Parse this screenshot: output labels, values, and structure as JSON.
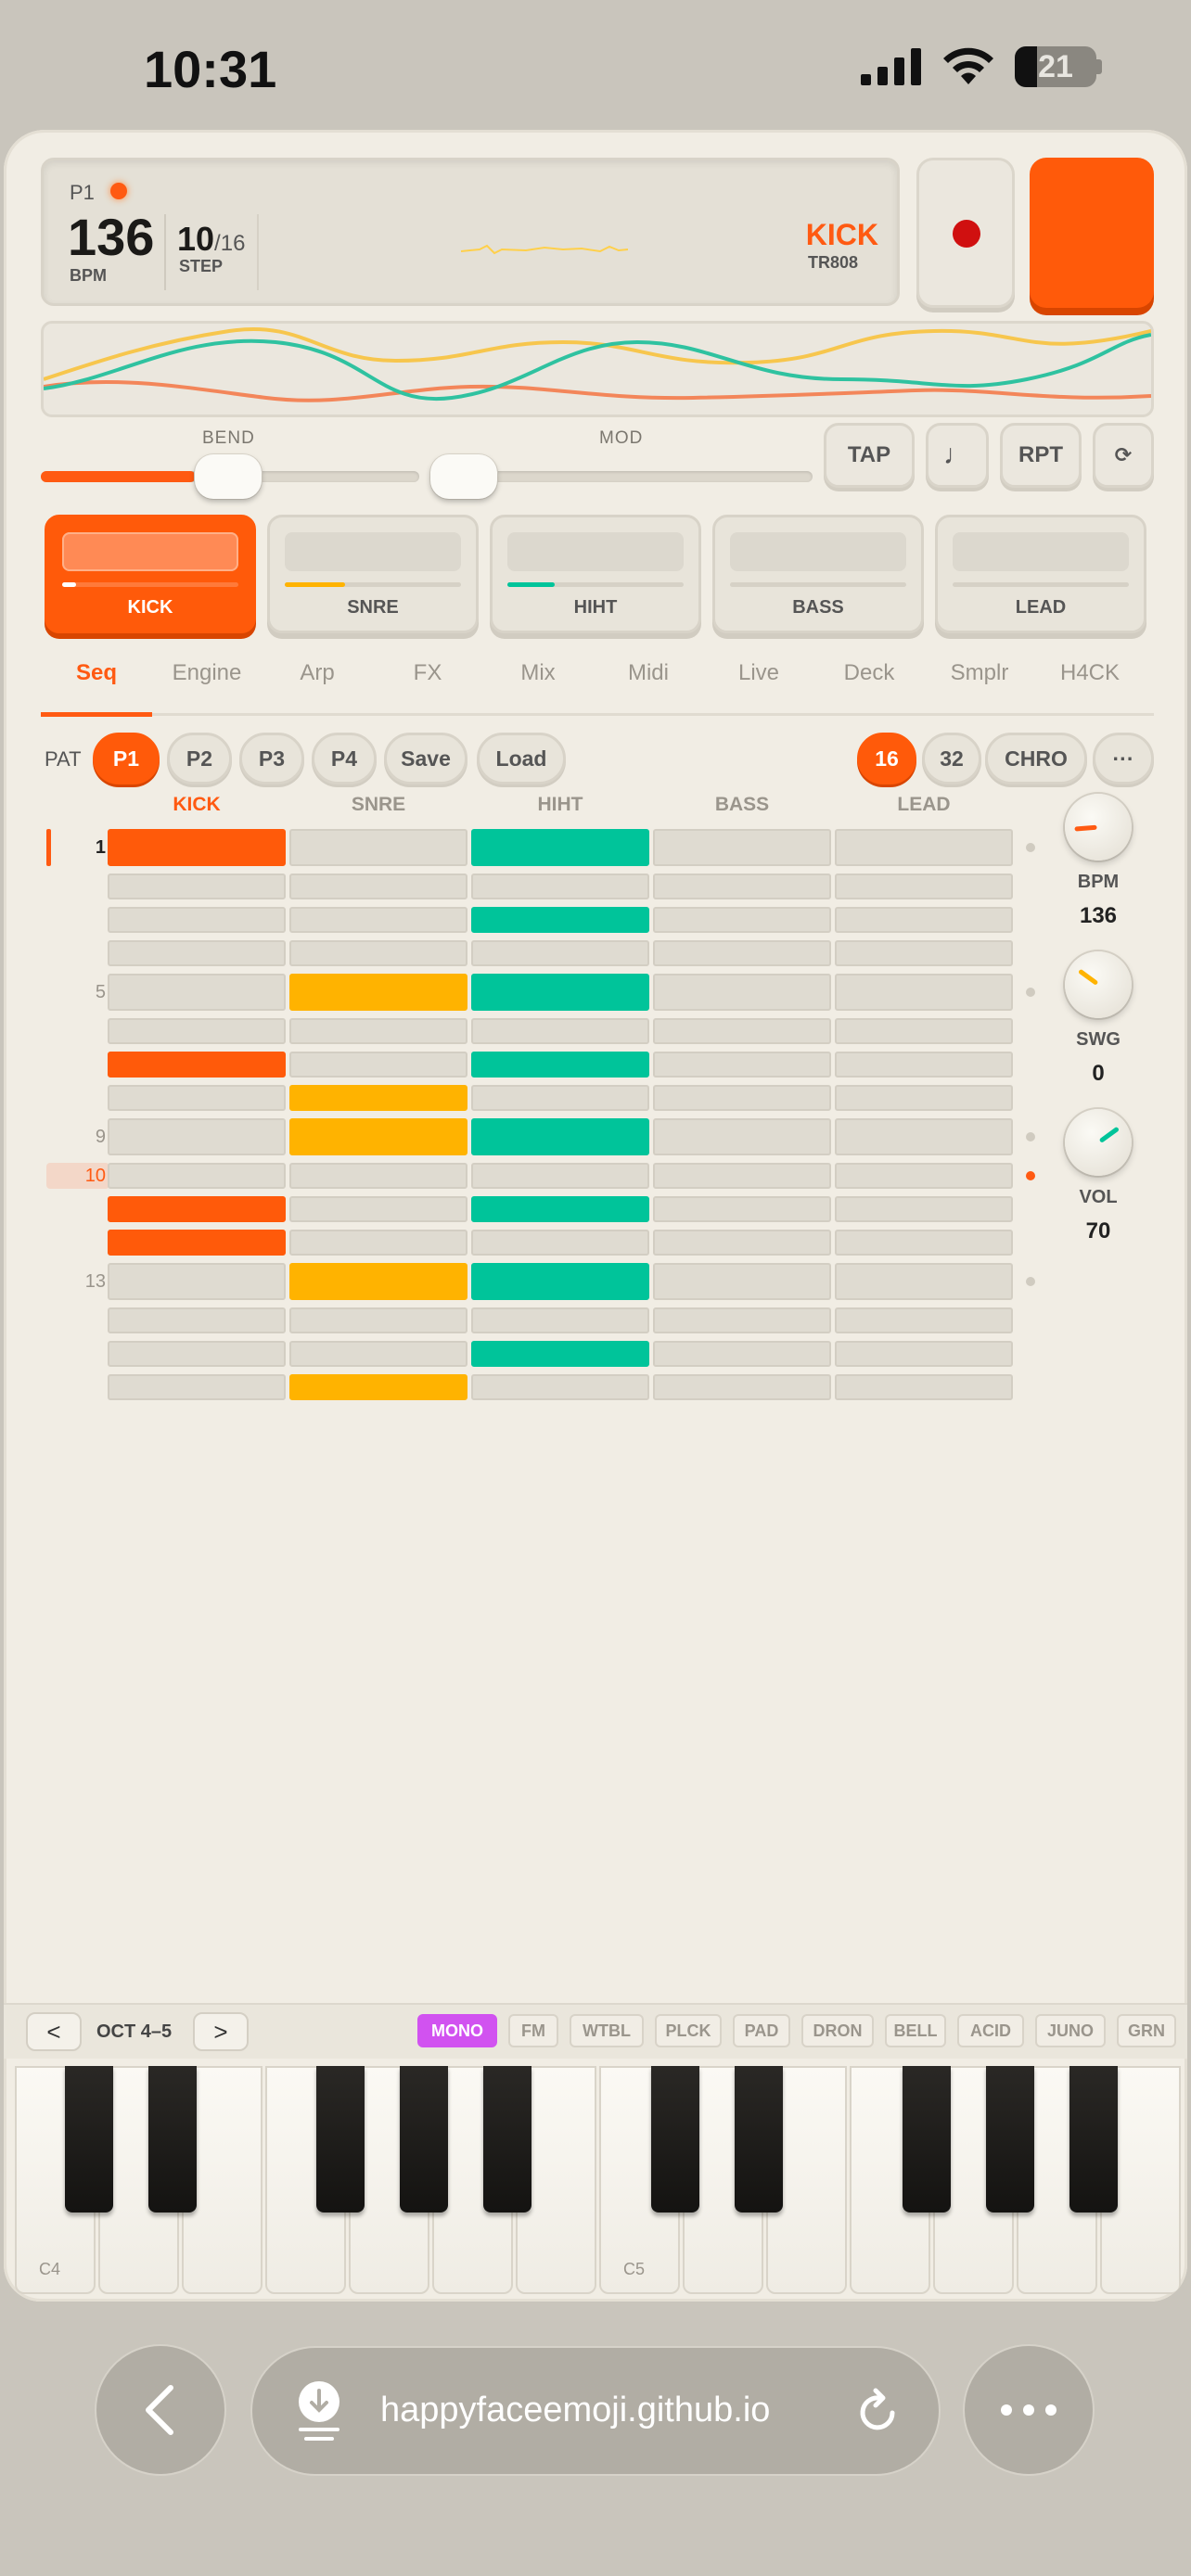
{
  "status": {
    "time": "10:31",
    "battery": "21"
  },
  "display": {
    "pattern": "P1",
    "bpm": "136",
    "bpm_label": "BPM",
    "step": "10",
    "step_total": "/16",
    "step_label": "STEP",
    "instrument": "KICK",
    "kit": "TR808"
  },
  "sliders": {
    "bend_label": "BEND",
    "mod_label": "MOD",
    "bend_level": 0.41,
    "mod_level": 0.04
  },
  "buttons": {
    "tap": "TAP",
    "note": "♩",
    "repeat": "RPT",
    "loop": "⟳"
  },
  "tracks": [
    {
      "label": "KICK",
      "active": true,
      "level": 0.08,
      "color": "#ffffff"
    },
    {
      "label": "SNRE",
      "active": false,
      "level": 0.34,
      "color": "#ffb300"
    },
    {
      "label": "HIHT",
      "active": false,
      "level": 0.27,
      "color": "#00c49a"
    },
    {
      "label": "BASS",
      "active": false,
      "level": 0,
      "color": "#ffb300"
    },
    {
      "label": "LEAD",
      "active": false,
      "level": 0,
      "color": "#ffb300"
    }
  ],
  "tabs": [
    "Seq",
    "Engine",
    "Arp",
    "FX",
    "Mix",
    "Midi",
    "Live",
    "Deck",
    "Smplr",
    "H4CK"
  ],
  "active_tab": "Seq",
  "patterns": {
    "label": "PAT",
    "items": [
      "P1",
      "P2",
      "P3",
      "P4"
    ],
    "save": "Save",
    "load": "Load",
    "len16": "16",
    "len32": "32",
    "chord": "CHRO",
    "more": "···"
  },
  "grid": {
    "columns": [
      "KICK",
      "SNRE",
      "HIHT",
      "BASS",
      "LEAD"
    ],
    "row_numbers": {
      "1": "1",
      "5": "5",
      "9": "9",
      "10": "10",
      "13": "13"
    },
    "current_step": 10,
    "steps": [
      [
        1,
        0,
        1,
        0,
        0
      ],
      [
        0,
        0,
        0,
        0,
        0
      ],
      [
        0,
        0,
        1,
        0,
        0
      ],
      [
        0,
        0,
        0,
        0,
        0
      ],
      [
        0,
        1,
        1,
        0,
        0
      ],
      [
        0,
        0,
        0,
        0,
        0
      ],
      [
        1,
        0,
        1,
        0,
        0
      ],
      [
        0,
        1,
        0,
        0,
        0
      ],
      [
        0,
        1,
        1,
        0,
        0
      ],
      [
        0,
        0,
        0,
        0,
        0
      ],
      [
        1,
        0,
        1,
        0,
        0
      ],
      [
        1,
        0,
        0,
        0,
        0
      ],
      [
        0,
        1,
        1,
        0,
        0
      ],
      [
        0,
        0,
        0,
        0,
        0
      ],
      [
        0,
        0,
        1,
        0,
        0
      ],
      [
        0,
        1,
        0,
        0,
        0
      ]
    ]
  },
  "knobs": [
    {
      "label": "BPM",
      "value": "136",
      "color": "#ff5a12",
      "level": 0.15
    },
    {
      "label": "SWG",
      "value": "0",
      "color": "#ffb300",
      "level": 0.3
    },
    {
      "label": "VOL",
      "value": "70",
      "color": "#00c49a",
      "level": 0.7
    }
  ],
  "keyboard": {
    "octave_label": "OCT 4–5",
    "prev": "<",
    "next": ">",
    "synths": [
      "MONO",
      "FM",
      "WTBL",
      "PLCK",
      "PAD",
      "DRON",
      "BELL",
      "ACID",
      "JUNO",
      "GRN"
    ],
    "active_synth": "MONO",
    "labels": {
      "c4": "C4",
      "c5": "C5"
    }
  },
  "browser": {
    "url": "happyfaceemoji.github.io"
  },
  "colors": {
    "accent": "#ff5a12",
    "snare": "#ffb300",
    "hihat": "#00c49a",
    "synth_active": "#d152f0"
  }
}
